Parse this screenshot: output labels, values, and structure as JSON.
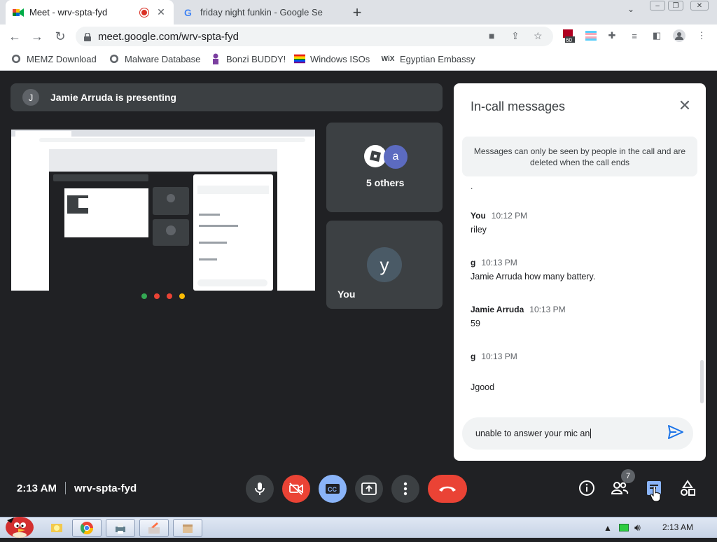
{
  "browser": {
    "tabs": [
      {
        "title": "Meet - wrv-spta-fyd",
        "active": true
      },
      {
        "title": "friday night funkin - Google Se",
        "active": false
      }
    ],
    "url": "meet.google.com/wrv-spta-fyd",
    "extension_badge": "60",
    "bookmarks": [
      {
        "label": "MEMZ Download",
        "icon": "globe-icon"
      },
      {
        "label": "Malware Database",
        "icon": "globe-icon"
      },
      {
        "label": "Bonzi BUDDY!",
        "icon": "bonzi-icon"
      },
      {
        "label": "Windows ISOs",
        "icon": "rainbow-flag-icon"
      },
      {
        "label": "Egyptian Embassy",
        "icon": "wix-icon"
      }
    ]
  },
  "meeting": {
    "presenting_initial": "J",
    "presenting_text": "Jamie Arruda is presenting",
    "others_initial": "a",
    "others_label": "5 others",
    "self_initial": "y",
    "self_label": "You",
    "time": "2:13 AM",
    "code": "wrv-spta-fyd",
    "people_count": "7"
  },
  "chat": {
    "title": "In-call messages",
    "notice": "Messages can only be seen by people in the call and are deleted when the call ends",
    "partial_line": ".",
    "messages": [
      {
        "sender": "You",
        "time": "10:12 PM",
        "text": "riley"
      },
      {
        "sender": "g",
        "time": "10:13 PM",
        "text": "Jamie Arruda how many battery."
      },
      {
        "sender": "Jamie Arruda",
        "time": "10:13 PM",
        "text": "59"
      },
      {
        "sender": "g",
        "time": "10:13 PM",
        "text": ""
      },
      {
        "sender": "",
        "time": "",
        "text": "Jgood"
      }
    ],
    "draft": "unable to answer your mic an"
  },
  "taskbar": {
    "clock": "2:13 AM"
  },
  "colors": {
    "meet_dark": "#202124",
    "tile": "#3c4043",
    "end_call": "#ea4335",
    "accent_blue": "#8ab4f8",
    "send_blue": "#1a73e8"
  }
}
